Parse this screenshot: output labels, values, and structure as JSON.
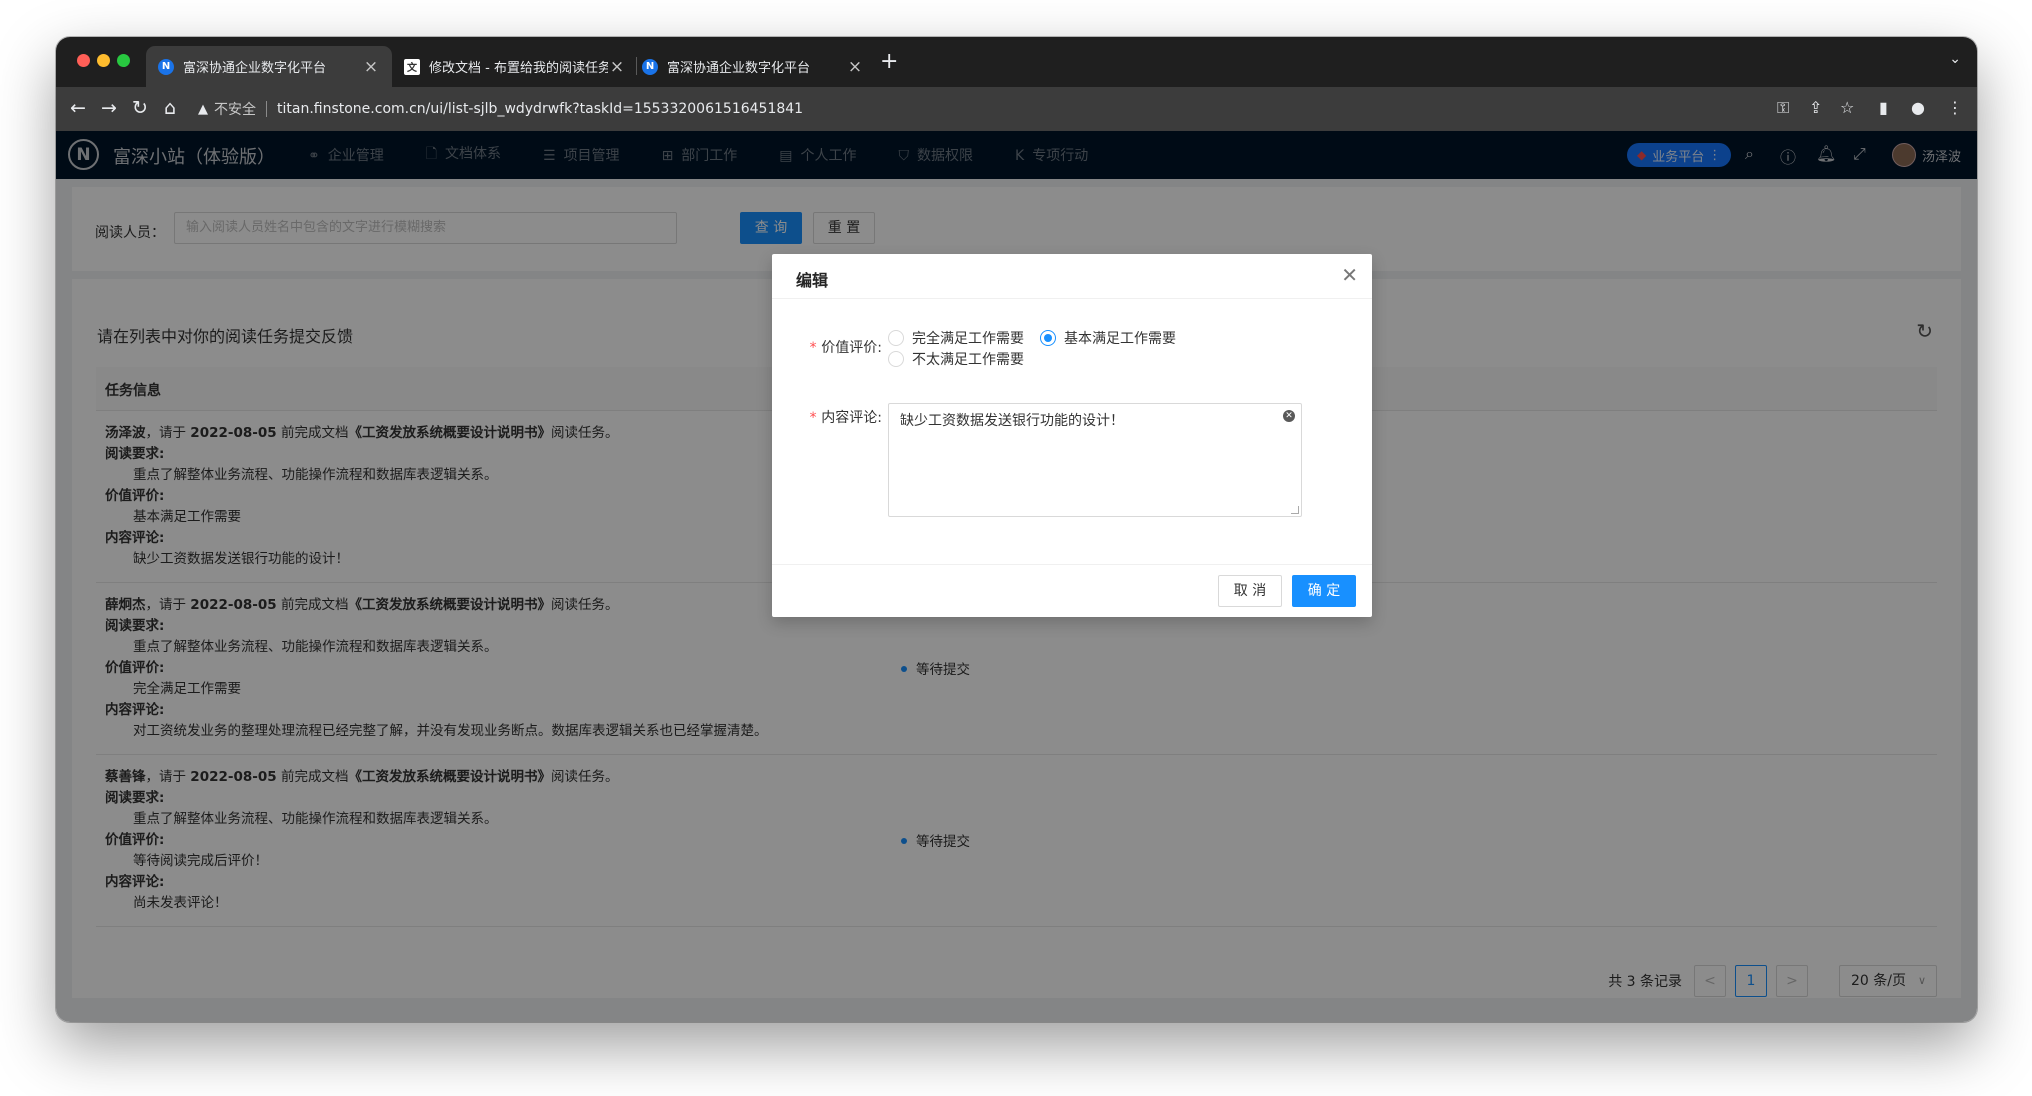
{
  "browser": {
    "tabs": [
      {
        "favicon": "N",
        "title": "富深协通企业数字化平台",
        "close": "×"
      },
      {
        "favicon": "文",
        "title": "修改文档 - 布置给我的阅读任务",
        "close": "×"
      },
      {
        "favicon": "N",
        "title": "富深协通企业数字化平台",
        "close": "×"
      }
    ],
    "new_tab": "+",
    "security_warning": "不安全",
    "url": "titan.finstone.com.cn/ui/list-sjlb_wdydrwfk?taskId=1553320061516451841"
  },
  "app": {
    "logo": "N",
    "brand": "富深小站（体验版）",
    "menu": [
      {
        "icon": "⚭",
        "label": "企业管理"
      },
      {
        "icon": "🗋",
        "label": "文档体系"
      },
      {
        "icon": "☰",
        "label": "项目管理"
      },
      {
        "icon": "⊞",
        "label": "部门工作"
      },
      {
        "icon": "▤",
        "label": "个人工作"
      },
      {
        "icon": "⛉",
        "label": "数据权限"
      },
      {
        "icon": "K",
        "label": "专项行动"
      }
    ],
    "platform_button": "业务平台",
    "username": "汤泽波"
  },
  "search": {
    "label": "阅读人员：",
    "placeholder": "输入阅读人员姓名中包含的文字进行模糊搜索",
    "query_button": "查 询",
    "reset_button": "重 置"
  },
  "list": {
    "title": "请在列表中对你的阅读任务提交反馈",
    "column_header": "任务信息",
    "rows": [
      {
        "person": "汤泽波",
        "prefix": "，请于 ",
        "date": "2022-08-05",
        "mid": " 前完成文档",
        "doc": "《工资发放系统概要设计说明书》",
        "suffix": "阅读任务。",
        "req_label": "阅读要求:",
        "requirement": "重点了解整体业务流程、功能操作流程和数据库表逻辑关系。",
        "value_label": "价值评价:",
        "value": "基本满足工作需要",
        "comment_label": "内容评论:",
        "comment": "缺少工资数据发送银行功能的设计！",
        "status": ""
      },
      {
        "person": "薛炯杰",
        "prefix": "，请于 ",
        "date": "2022-08-05",
        "mid": " 前完成文档",
        "doc": "《工资发放系统概要设计说明书》",
        "suffix": "阅读任务。",
        "req_label": "阅读要求:",
        "requirement": "重点了解整体业务流程、功能操作流程和数据库表逻辑关系。",
        "value_label": "价值评价:",
        "value": "完全满足工作需要",
        "comment_label": "内容评论:",
        "comment": "对工资统发业务的整理处理流程已经完整了解，并没有发现业务断点。数据库表逻辑关系也已经掌握清楚。",
        "status": "等待提交"
      },
      {
        "person": "蔡善锋",
        "prefix": "，请于 ",
        "date": "2022-08-05",
        "mid": " 前完成文档",
        "doc": "《工资发放系统概要设计说明书》",
        "suffix": "阅读任务。",
        "req_label": "阅读要求:",
        "requirement": "重点了解整体业务流程、功能操作流程和数据库表逻辑关系。",
        "value_label": "价值评价:",
        "value": "等待阅读完成后评价！",
        "comment_label": "内容评论:",
        "comment": "尚未发表评论！",
        "status": "等待提交"
      }
    ]
  },
  "pagination": {
    "total_text": "共 3 条记录",
    "prev": "<",
    "current_page": "1",
    "next": ">",
    "page_size": "20 条/页"
  },
  "modal": {
    "title": "编辑",
    "value_label": "价值评价:",
    "options": [
      "完全满足工作需要",
      "基本满足工作需要",
      "不太满足工作需要"
    ],
    "selected_option": "基本满足工作需要",
    "comment_label": "内容评论:",
    "comment_value": "缺少工资数据发送银行功能的设计！",
    "cancel_label": "取 消",
    "ok_label": "确 定"
  },
  "colors": {
    "primary": "#1890ff",
    "header_bg": "#001529",
    "required": "#ff4d4f"
  }
}
